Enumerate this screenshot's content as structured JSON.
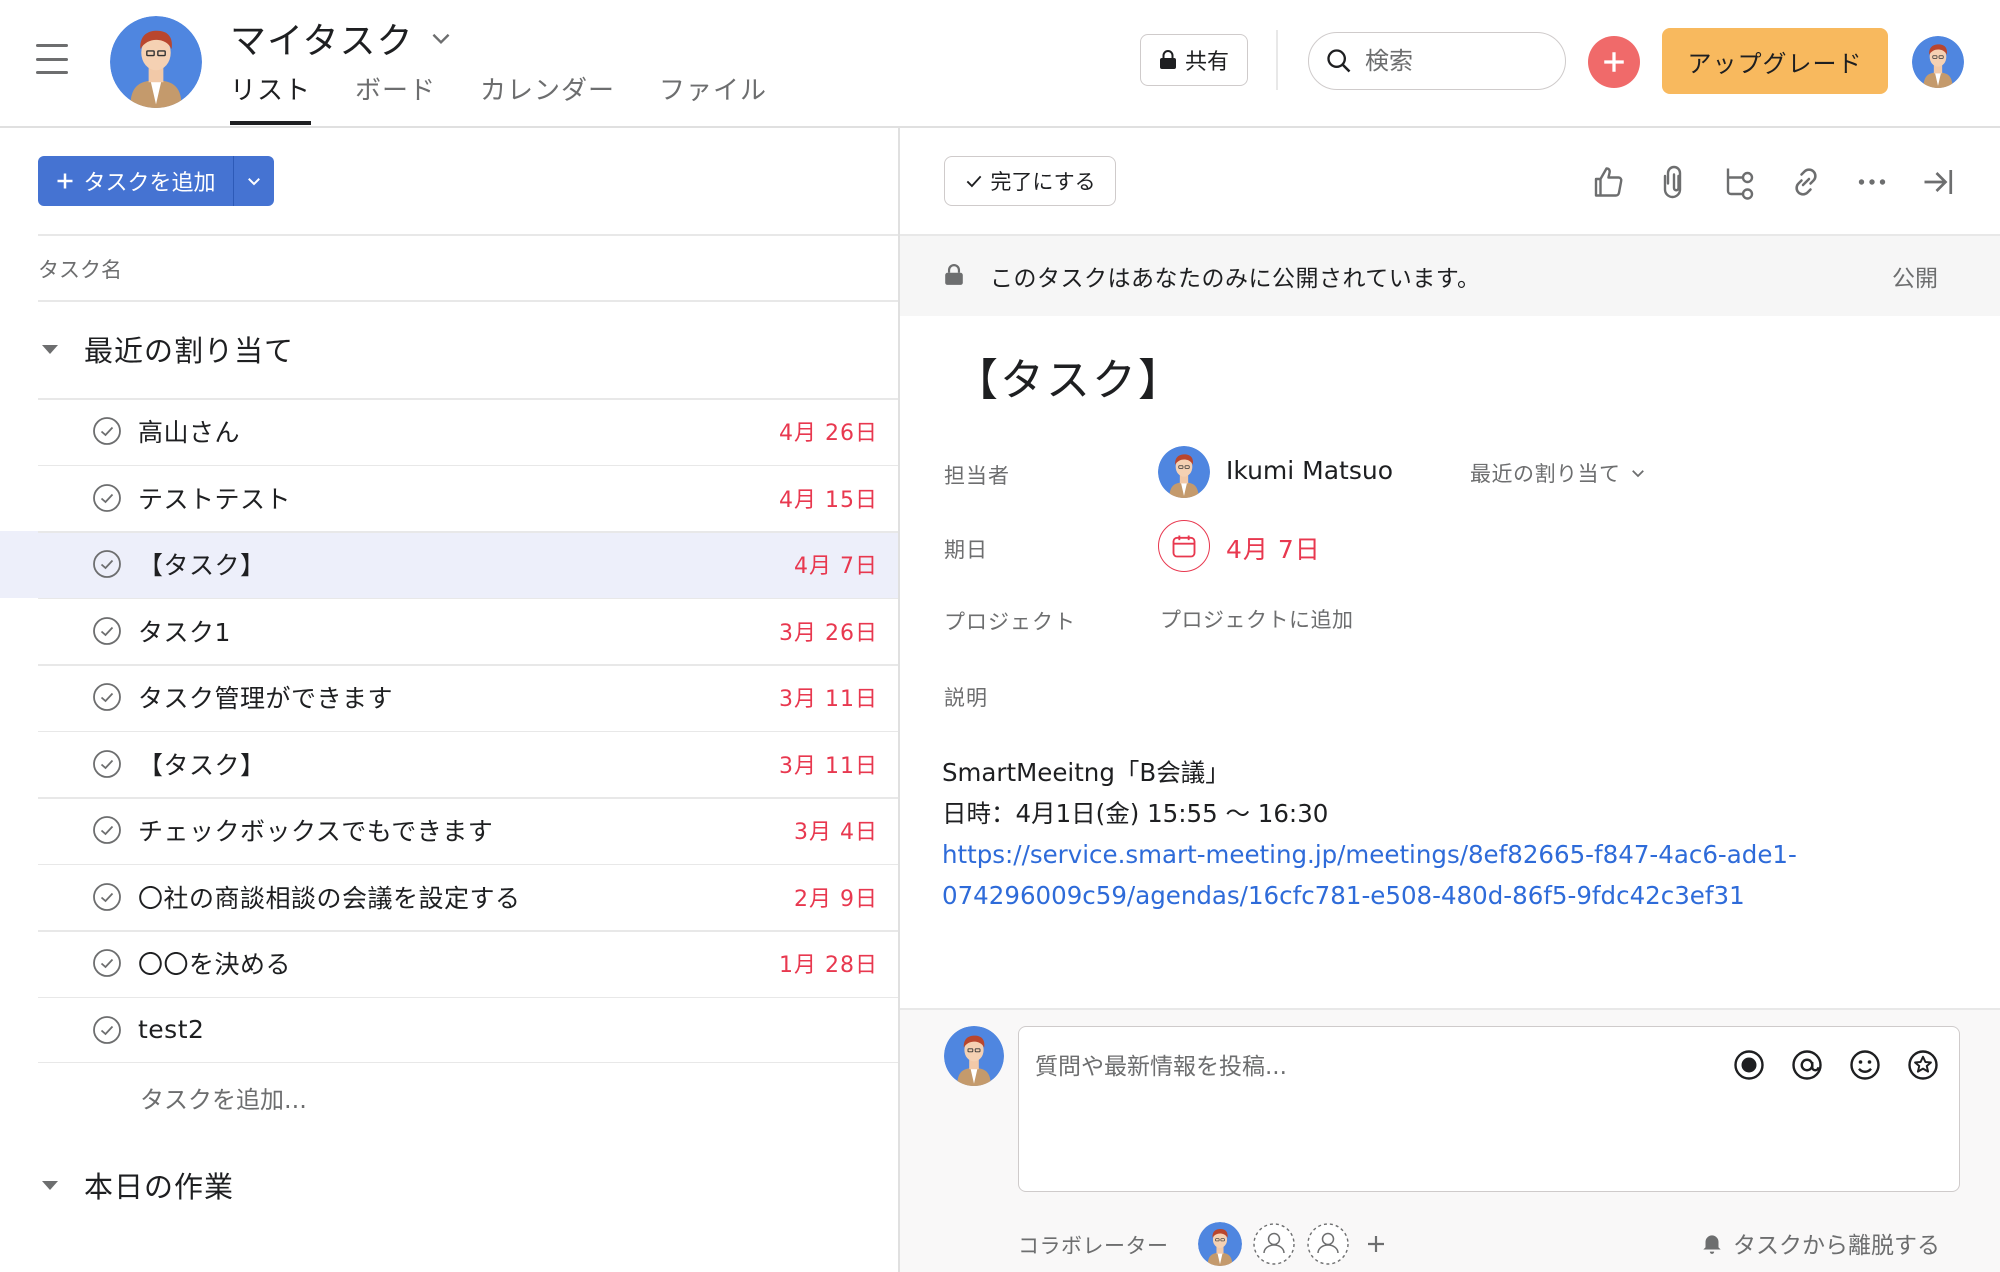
{
  "header": {
    "title": "マイタスク",
    "tabs": [
      {
        "label": "リスト",
        "active": true
      },
      {
        "label": "ボード",
        "active": false
      },
      {
        "label": "カレンダー",
        "active": false
      },
      {
        "label": "ファイル",
        "active": false
      }
    ],
    "share_label": "共有",
    "search_placeholder": "検索",
    "upgrade_label": "アップグレード"
  },
  "colors": {
    "accent_blue": "#4573d2",
    "due_red": "#e8384f",
    "upgrade_orange": "#f8b95e",
    "add_red": "#f06a6a",
    "selected_row": "#edeffa"
  },
  "list": {
    "add_task_label": "タスクを追加",
    "column_header": "タスク名",
    "sections": [
      {
        "title": "最近の割り当て",
        "tasks": [
          {
            "name": "高山さん",
            "due": "4月 26日",
            "selected": false
          },
          {
            "name": "テストテスト",
            "due": "4月 15日",
            "selected": false
          },
          {
            "name": "【タスク】",
            "due": "4月 7日",
            "selected": true
          },
          {
            "name": "タスク1",
            "due": "3月 26日",
            "selected": false
          },
          {
            "name": "タスク管理ができます",
            "due": "3月 11日",
            "selected": false
          },
          {
            "name": "【タスク】",
            "due": "3月 11日",
            "selected": false
          },
          {
            "name": "チェックボックスでもできます",
            "due": "3月 4日",
            "selected": false
          },
          {
            "name": "〇社の商談相談の会議を設定する",
            "due": "2月 9日",
            "selected": false
          },
          {
            "name": "〇〇を決める",
            "due": "1月 28日",
            "selected": false
          },
          {
            "name": "test2",
            "due": "",
            "selected": false
          }
        ],
        "add_inline_label": "タスクを追加..."
      },
      {
        "title": "本日の作業",
        "tasks": []
      }
    ],
    "peek_text": "本日の作業"
  },
  "detail": {
    "complete_label": "完了にする",
    "toolbar_icons": [
      "like-icon",
      "attachment-icon",
      "subtask-icon",
      "link-icon",
      "more-icon",
      "close-panel-icon"
    ],
    "privacy_text": "このタスクはあなたのみに公開されています。",
    "privacy_action": "公開",
    "task_title": "【タスク】",
    "fields": {
      "assignee_label": "担当者",
      "assignee_name": "Ikumi Matsuo",
      "assignee_section": "最近の割り当て",
      "due_label": "期日",
      "due_value": "4月 7日",
      "project_label": "プロジェクト",
      "project_add": "プロジェクトに追加",
      "description_label": "説明"
    },
    "description": {
      "line1": "SmartMeeitng「B会議」",
      "line2": "日時：4月1日(金) 15:55 〜 16:30",
      "link_line1": "https://service.smart-meeting.jp/meetings/8ef82665-f847-4ac6-ade1-",
      "link_line2": "074296009c59/agendas/16cfc781-e508-480d-86f5-9fdc42c3ef31"
    },
    "comment": {
      "placeholder": "質問や最新情報を投稿...",
      "tools": [
        "record-icon",
        "mention-icon",
        "emoji-icon",
        "star-icon"
      ]
    },
    "collaborators_label": "コラボレーター",
    "leave_task_label": "タスクから離脱する"
  }
}
